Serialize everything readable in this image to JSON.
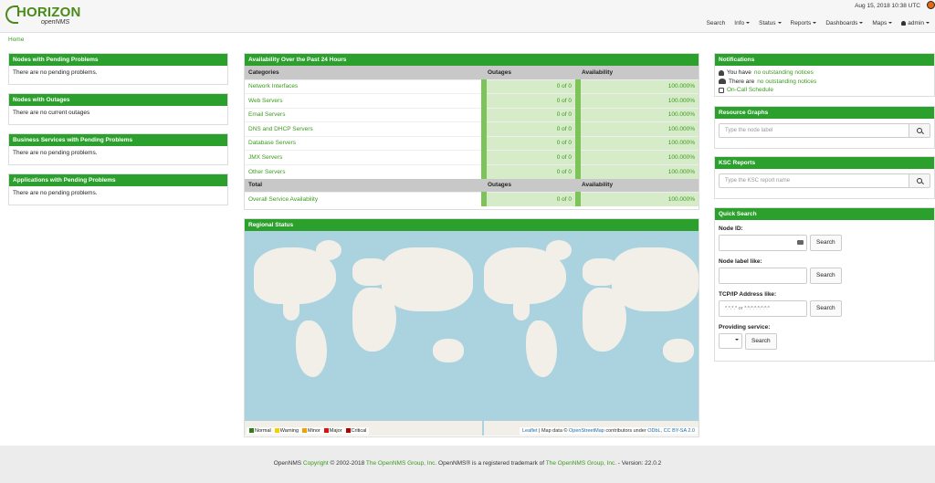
{
  "header": {
    "logo_main": "HORIZON",
    "logo_sub": "openNMS",
    "datetime": "Aug 15, 2018 10:38 UTC",
    "nav": {
      "search": "Search",
      "info": "Info",
      "status": "Status",
      "reports": "Reports",
      "dashboards": "Dashboards",
      "maps": "Maps",
      "user": "admin"
    }
  },
  "breadcrumb": "Home",
  "left_panels": [
    {
      "title": "Nodes with Pending Problems",
      "body": "There are no pending problems."
    },
    {
      "title": "Nodes with Outages",
      "body": "There are no current outages"
    },
    {
      "title": "Business Services with Pending Problems",
      "body": "There are no pending problems."
    },
    {
      "title": "Applications with Pending Problems",
      "body": "There are no pending problems."
    }
  ],
  "availability": {
    "title": "Availability Over the Past 24 Hours",
    "headers": {
      "categories": "Categories",
      "outages": "Outages",
      "availability": "Availability"
    },
    "rows": [
      {
        "category": "Network Interfaces",
        "outages": "0 of 0",
        "availability": "100.000%"
      },
      {
        "category": "Web Servers",
        "outages": "0 of 0",
        "availability": "100.000%"
      },
      {
        "category": "Email Servers",
        "outages": "0 of 0",
        "availability": "100.000%"
      },
      {
        "category": "DNS and DHCP Servers",
        "outages": "0 of 0",
        "availability": "100.000%"
      },
      {
        "category": "Database Servers",
        "outages": "0 of 0",
        "availability": "100.000%"
      },
      {
        "category": "JMX Servers",
        "outages": "0 of 0",
        "availability": "100.000%"
      },
      {
        "category": "Other Servers",
        "outages": "0 of 0",
        "availability": "100.000%"
      }
    ],
    "total_headers": {
      "total": "Total",
      "outages": "Outages",
      "availability": "Availability"
    },
    "total_row": {
      "category": "Overall Service Availability",
      "outages": "0 of 0",
      "availability": "100.000%"
    }
  },
  "regional": {
    "title": "Regional Status",
    "legend": [
      {
        "label": "Normal",
        "color": "#2e7d1a"
      },
      {
        "label": "Warning",
        "color": "#f5d000"
      },
      {
        "label": "Minor",
        "color": "#f0a000"
      },
      {
        "label": "Major",
        "color": "#e01010"
      },
      {
        "label": "Critical",
        "color": "#b00000"
      }
    ],
    "attribution": {
      "leaflet": "Leaflet",
      "sep": " | Map data © ",
      "osm": "OpenStreetMap",
      "mid": " contributors under ",
      "license": "ODbL, CC BY-SA 2.0"
    }
  },
  "notifications": {
    "title": "Notifications",
    "you_prefix": "You have ",
    "you_link": "no outstanding notices",
    "there_prefix": "There are ",
    "there_link": "no outstanding notices",
    "oncall": "On-Call Schedule"
  },
  "resource_graphs": {
    "title": "Resource Graphs",
    "placeholder": "Type the node label"
  },
  "ksc_reports": {
    "title": "KSC Reports",
    "placeholder": "Type the KSC report name"
  },
  "quick_search": {
    "title": "Quick Search",
    "node_id_label": "Node ID:",
    "node_label_label": "Node label like:",
    "tcpip_label": "TCP/IP Address like:",
    "tcpip_placeholder": "*.*.*.* or *:*:*:*:*:*:*:*",
    "service_label": "Providing service:",
    "search_btn": "Search"
  },
  "footer": {
    "pre": "OpenNMS ",
    "copyright": "Copyright",
    "mid1": " © 2002-2018 ",
    "group1": "The OpenNMS Group, Inc.",
    "mid2": " OpenNMS® is a registered trademark of ",
    "group2": "The OpenNMS Group, Inc.",
    "version": " - Version: 22.0.2"
  }
}
